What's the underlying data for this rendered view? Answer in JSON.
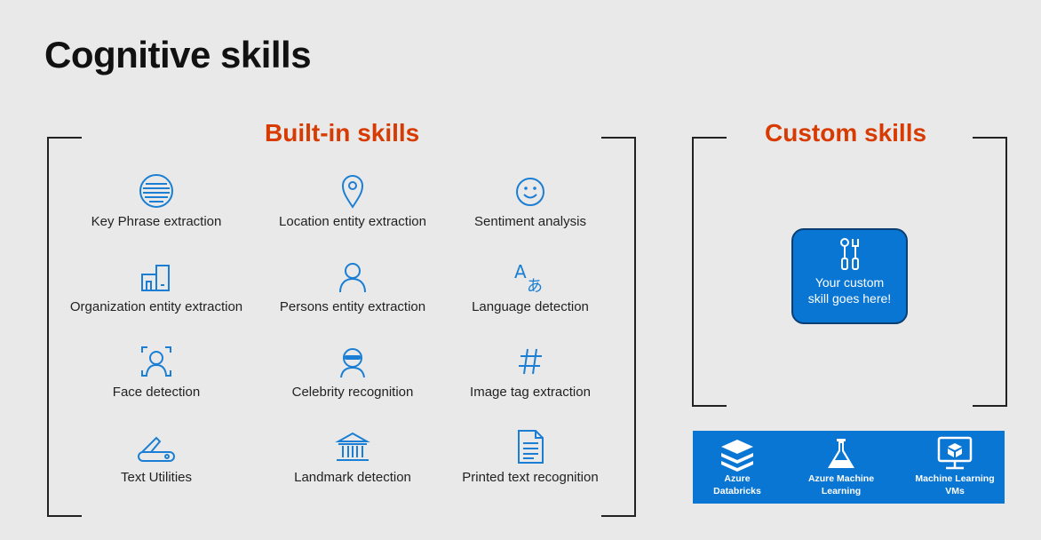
{
  "title": "Cognitive skills",
  "builtin": {
    "heading": "Built-in skills",
    "items": [
      {
        "label": "Key Phrase extraction"
      },
      {
        "label": "Location entity extraction"
      },
      {
        "label": "Sentiment analysis"
      },
      {
        "label": "Organization entity extraction"
      },
      {
        "label": "Persons entity extraction"
      },
      {
        "label": "Language detection"
      },
      {
        "label": "Face detection"
      },
      {
        "label": "Celebrity recognition"
      },
      {
        "label": "Image tag extraction"
      },
      {
        "label": "Text Utilities"
      },
      {
        "label": "Landmark detection"
      },
      {
        "label": "Printed text recognition"
      }
    ]
  },
  "custom": {
    "heading": "Custom skills",
    "box_line1": "Your custom",
    "box_line2": "skill goes here!"
  },
  "services": [
    {
      "line1": "Azure",
      "line2": "Databricks"
    },
    {
      "line1": "Azure Machine",
      "line2": "Learning"
    },
    {
      "line1": "Machine Learning",
      "line2": "VMs"
    }
  ],
  "colors": {
    "accent": "#d83b01",
    "icon_blue": "#1a7fd4",
    "box_blue": "#0a76d4"
  }
}
